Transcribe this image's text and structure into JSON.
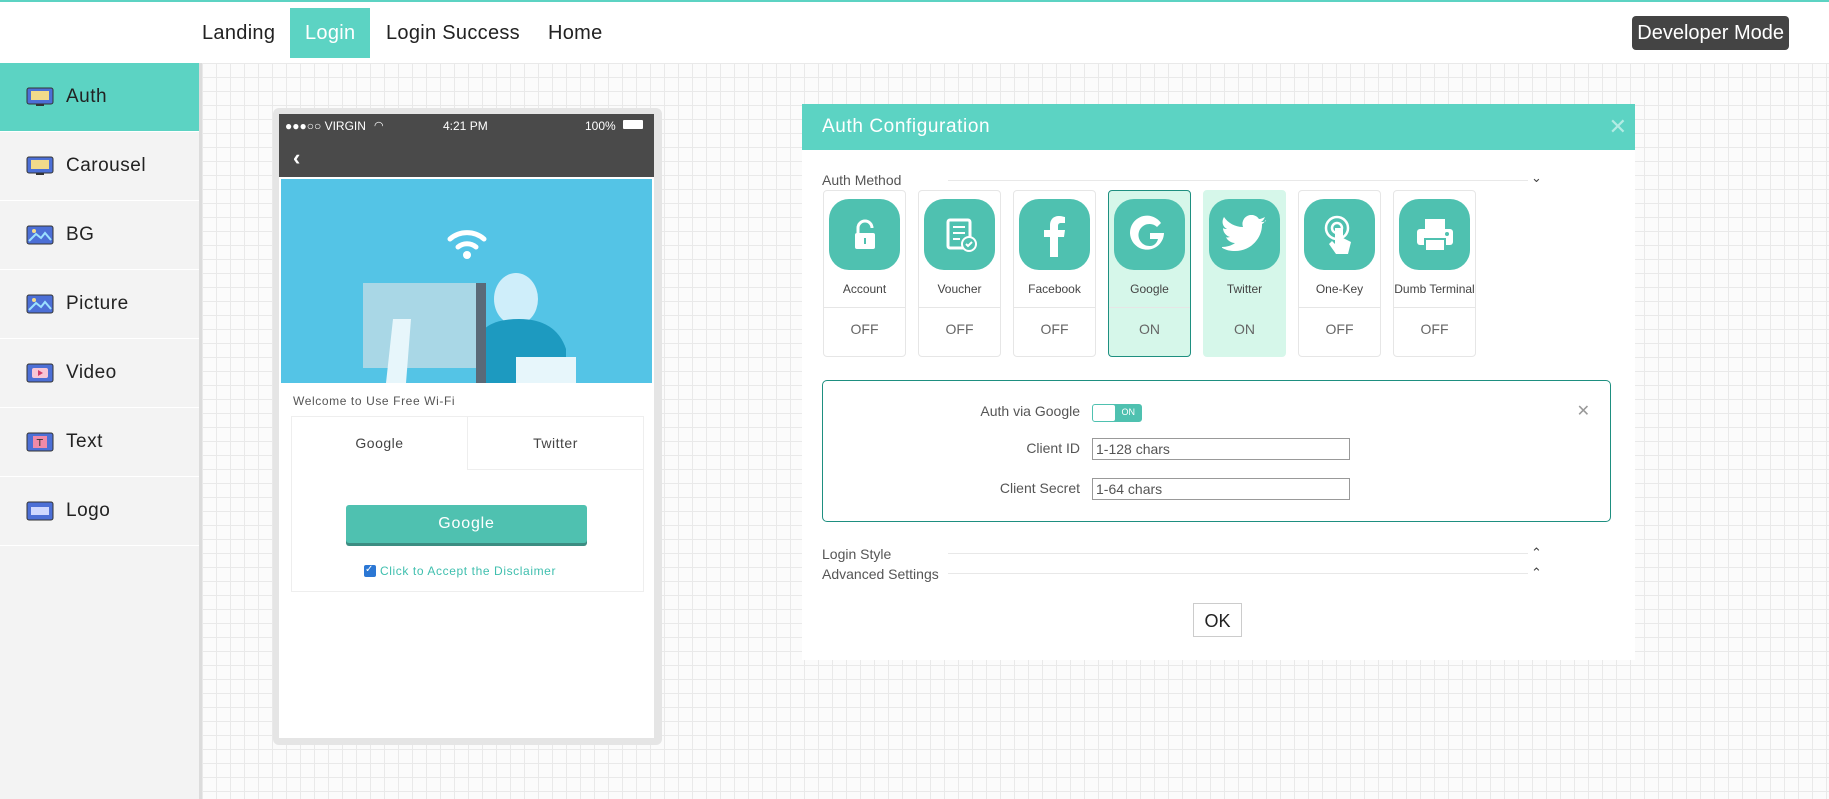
{
  "nav": {
    "tabs": [
      {
        "label": "Landing"
      },
      {
        "label": "Login"
      },
      {
        "label": "Login Success"
      },
      {
        "label": "Home"
      }
    ],
    "developer_mode": "Developer Mode"
  },
  "sidebar": {
    "items": [
      {
        "label": "Auth",
        "icon": "monitor-icon"
      },
      {
        "label": "Carousel",
        "icon": "monitor-icon"
      },
      {
        "label": "BG",
        "icon": "image-icon"
      },
      {
        "label": "Picture",
        "icon": "image-icon"
      },
      {
        "label": "Video",
        "icon": "video-icon"
      },
      {
        "label": "Text",
        "icon": "text-icon"
      },
      {
        "label": "Logo",
        "icon": "logo-icon"
      }
    ]
  },
  "phone": {
    "carrier": "●●●○○ VIRGIN",
    "time": "4:21 PM",
    "battery": "100%",
    "welcome": "Welcome to Use Free Wi-Fi",
    "tabs": [
      "Google",
      "Twitter"
    ],
    "button": "Google",
    "disclaimer": "Click to Accept the Disclaimer"
  },
  "panel": {
    "title": "Auth Configuration",
    "auth_method_label": "Auth Method",
    "methods": [
      {
        "label": "Account",
        "state": "OFF",
        "icon": "lock-icon"
      },
      {
        "label": "Voucher",
        "state": "OFF",
        "icon": "voucher-icon"
      },
      {
        "label": "Facebook",
        "state": "OFF",
        "icon": "facebook-icon"
      },
      {
        "label": "Google",
        "state": "ON",
        "icon": "google-icon"
      },
      {
        "label": "Twitter",
        "state": "ON",
        "icon": "twitter-icon"
      },
      {
        "label": "One-Key",
        "state": "OFF",
        "icon": "tap-icon"
      },
      {
        "label": "Dumb Terminal",
        "state": "OFF",
        "icon": "printer-icon"
      }
    ],
    "config": {
      "auth_via_label": "Auth via Google",
      "toggle_text": "ON",
      "client_id_label": "Client ID",
      "client_id_placeholder": "1-128 chars",
      "client_secret_label": "Client Secret",
      "client_secret_placeholder": "1-64 chars"
    },
    "login_style_label": "Login Style",
    "advanced_label": "Advanced Settings",
    "ok": "OK"
  },
  "colors": {
    "accent": "#5cd3c3",
    "button": "#4fc1b0",
    "selected_border": "#1e8f80",
    "selected_bg": "#d6f7ea"
  }
}
